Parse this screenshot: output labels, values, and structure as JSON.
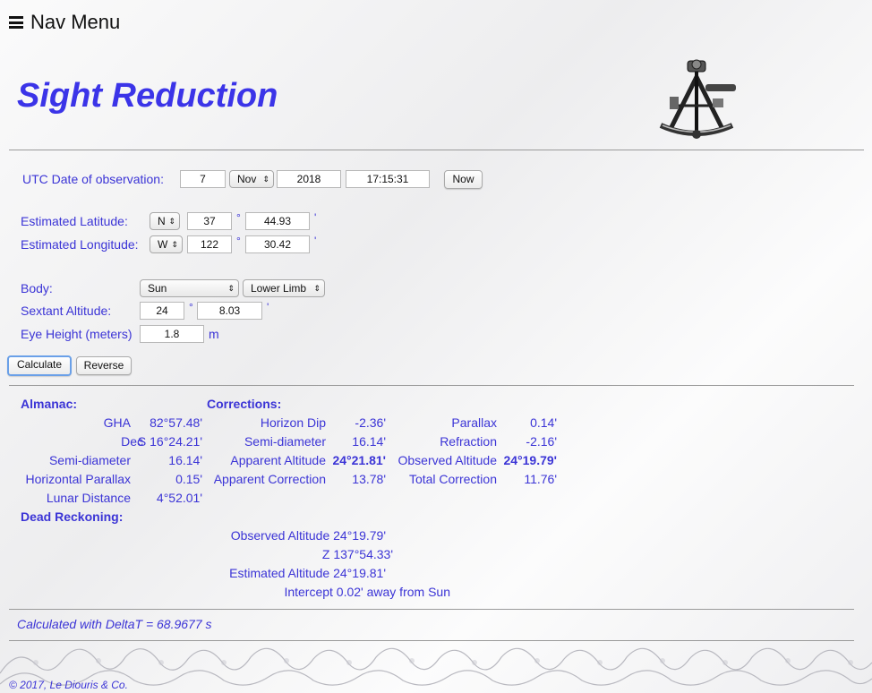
{
  "nav": {
    "label": "Nav Menu"
  },
  "title": "Sight Reduction",
  "date": {
    "label": "UTC Date of observation:",
    "day": "7",
    "month": "Nov",
    "year": "2018",
    "time": "17:15:31",
    "now_label": "Now"
  },
  "position": {
    "lat_label": "Estimated Latitude:",
    "lat_hemi": "N",
    "lat_deg": "37",
    "lat_min": "44.93",
    "lon_label": "Estimated Longitude:",
    "lon_hemi": "W",
    "lon_deg": "122",
    "lon_min": "30.42",
    "deg_symbol": "°",
    "min_symbol": "'"
  },
  "body": {
    "body_label": "Body:",
    "body_value": "Sun",
    "limb_value": "Lower Limb",
    "sextant_label": "Sextant Altitude:",
    "sextant_deg": "24",
    "sextant_min": "8.03",
    "eye_label": "Eye Height (meters)",
    "eye_value": "1.8",
    "eye_unit": "m"
  },
  "actions": {
    "calculate": "Calculate",
    "reverse": "Reverse"
  },
  "almanac": {
    "header": "Almanac:",
    "gha_label": "GHA",
    "gha_value": "82°57.48'",
    "dec_label": "Dec",
    "dec_value": "S 16°24.21'",
    "sd_label": "Semi-diameter",
    "sd_value": "16.14'",
    "hp_label": "Horizontal Parallax",
    "hp_value": "0.15'",
    "ld_label": "Lunar Distance",
    "ld_value": "4°52.01'"
  },
  "corrections": {
    "header": "Corrections:",
    "dip_label": "Horizon Dip",
    "dip_value": "-2.36'",
    "sd_label": "Semi-diameter",
    "sd_value": "16.14'",
    "app_alt_label": "Apparent Altitude",
    "app_alt_value": "24°21.81'",
    "app_corr_label": "Apparent Correction",
    "app_corr_value": "13.78'",
    "parallax_label": "Parallax",
    "parallax_value": "0.14'",
    "refraction_label": "Refraction",
    "refraction_value": "-2.16'",
    "obs_alt_label": "Observed Altitude",
    "obs_alt_value": "24°19.79'",
    "total_label": "Total Correction",
    "total_value": "11.76'"
  },
  "dead_reckoning": {
    "header": "Dead Reckoning:",
    "obs_alt": "Observed Altitude 24°19.79'",
    "z": "Z 137°54.33'",
    "est_alt": "Estimated Altitude 24°19.81'",
    "intercept": "Intercept 0.02' away from Sun"
  },
  "delta_t": "Calculated with DeltaT = 68.9677 s",
  "copyright": "© 2017, Le Diouris & Co.",
  "colors": {
    "accent": "#3b34d6",
    "title": "#3b34e8"
  }
}
